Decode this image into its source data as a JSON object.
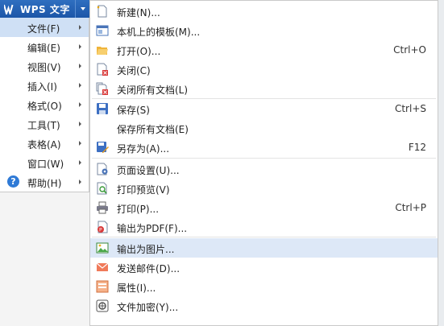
{
  "app": {
    "title": "WPS 文字"
  },
  "left_menu": [
    {
      "label": "文件(F)",
      "active": true
    },
    {
      "label": "编辑(E)"
    },
    {
      "label": "视图(V)"
    },
    {
      "label": "插入(I)"
    },
    {
      "label": "格式(O)"
    },
    {
      "label": "工具(T)"
    },
    {
      "label": "表格(A)"
    },
    {
      "label": "窗口(W)"
    },
    {
      "label": "帮助(H)",
      "icon": "help-icon"
    }
  ],
  "file_menu": [
    {
      "label": "新建(N)...",
      "icon": "new-document-icon"
    },
    {
      "label": "本机上的模板(M)...",
      "icon": "template-icon"
    },
    {
      "label": "打开(O)...",
      "icon": "open-folder-icon",
      "shortcut": "Ctrl+O"
    },
    {
      "label": "关闭(C)",
      "icon": "close-document-icon"
    },
    {
      "label": "关闭所有文档(L)",
      "icon": "close-all-icon"
    },
    {
      "label": "保存(S)",
      "icon": "save-icon",
      "shortcut": "Ctrl+S"
    },
    {
      "label": "保存所有文档(E)"
    },
    {
      "label": "另存为(A)...",
      "icon": "save-as-icon",
      "shortcut": "F12"
    },
    {
      "label": "页面设置(U)...",
      "icon": "page-setup-icon"
    },
    {
      "label": "打印预览(V)",
      "icon": "print-preview-icon"
    },
    {
      "label": "打印(P)...",
      "icon": "printer-icon",
      "shortcut": "Ctrl+P"
    },
    {
      "label": "输出为PDF(F)...",
      "icon": "pdf-icon"
    },
    {
      "label": "输出为图片...",
      "icon": "image-export-icon",
      "hover": true
    },
    {
      "label": "发送邮件(D)...",
      "icon": "mail-icon"
    },
    {
      "label": "属性(I)...",
      "icon": "properties-icon"
    },
    {
      "label": "文件加密(Y)...",
      "icon": "encrypt-icon"
    }
  ]
}
